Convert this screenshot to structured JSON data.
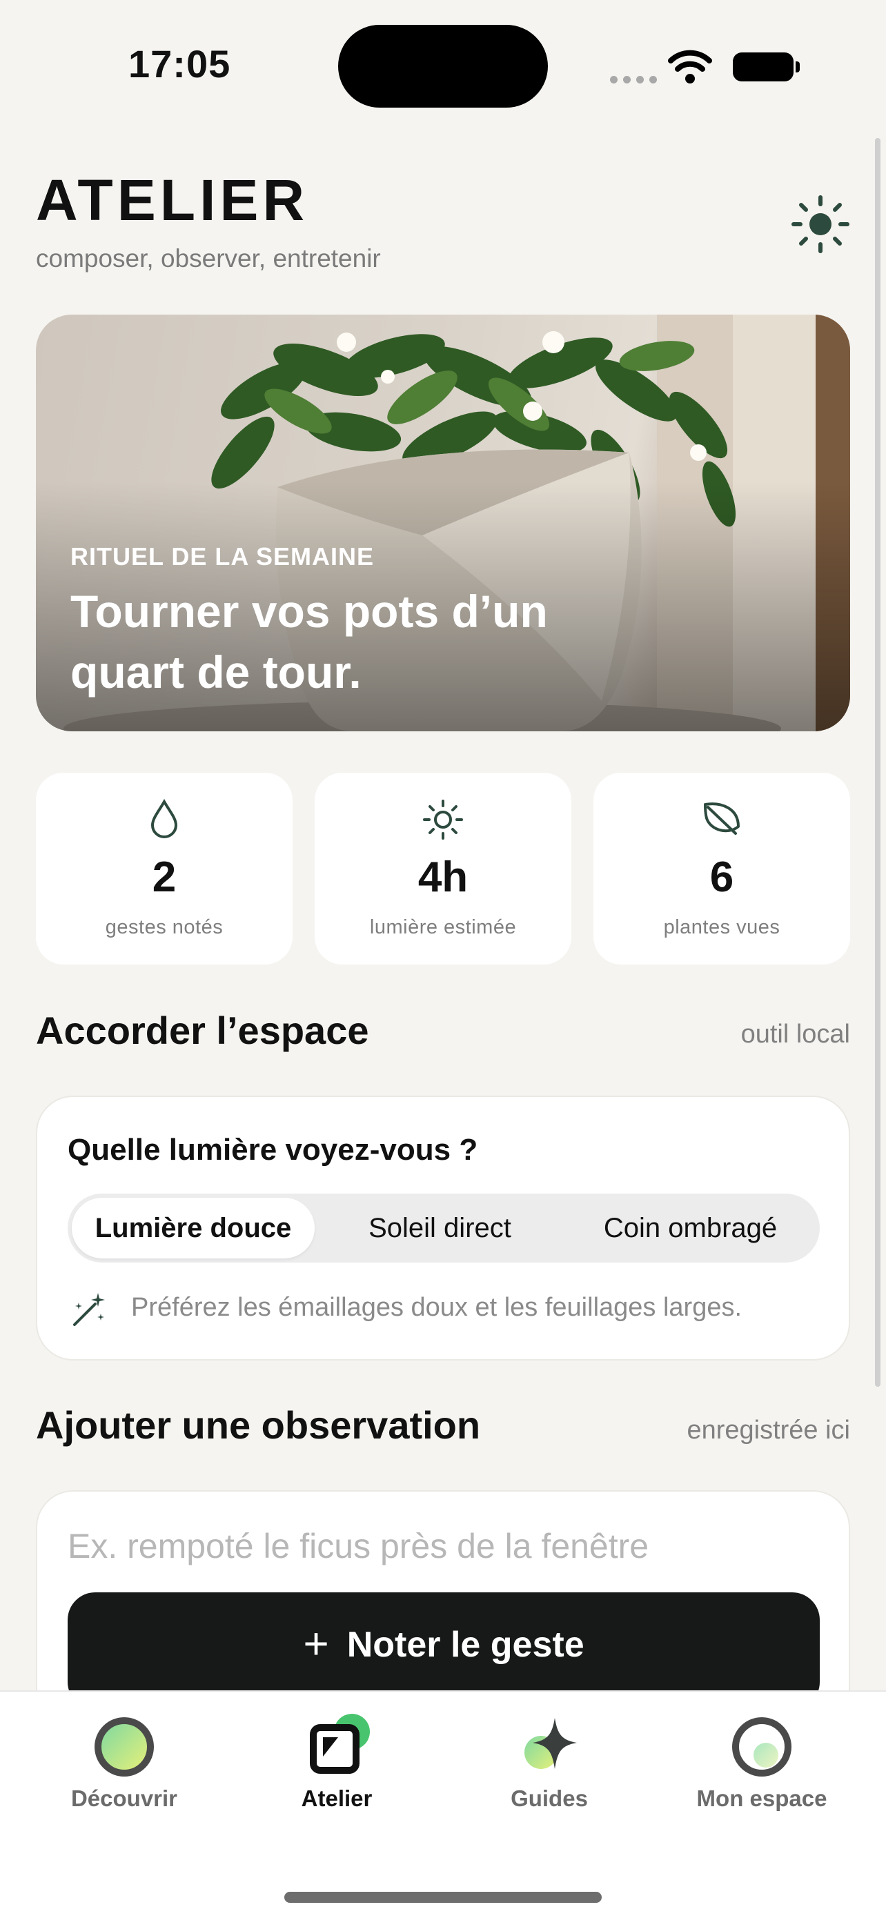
{
  "status_bar": {
    "time": "17:05"
  },
  "header": {
    "title": "ATELIER",
    "subtitle": "composer, observer, entretenir",
    "theme_icon": "sun-icon"
  },
  "hero": {
    "kicker": "RITUEL DE LA SEMAINE",
    "text": "Tourner vos pots d’un quart de tour."
  },
  "stats": [
    {
      "icon": "drop-icon",
      "value": "2",
      "label": "gestes notés"
    },
    {
      "icon": "sun-icon",
      "value": "4h",
      "label": "lumière estimée"
    },
    {
      "icon": "leaf-icon",
      "value": "6",
      "label": "plantes vues"
    }
  ],
  "space": {
    "title": "Accorder l’espace",
    "meta": "outil local",
    "question": "Quelle lumière voyez-vous ?",
    "options": [
      "Lumière douce",
      "Soleil direct",
      "Coin ombragé"
    ],
    "selected": "Lumière douce",
    "tip": "Préférez les émaillages doux et les feuillages larges."
  },
  "observation": {
    "title": "Ajouter une observation",
    "meta": "enregistrée ici",
    "placeholder": "Ex. rempoté le ficus près de la fenêtre",
    "button_label": "Noter le geste"
  },
  "tabbar": {
    "active": "Atelier",
    "tabs": [
      {
        "label": "Découvrir",
        "icon": "discover-icon"
      },
      {
        "label": "Atelier",
        "icon": "atelier-icon"
      },
      {
        "label": "Guides",
        "icon": "sparkle-icon"
      },
      {
        "label": "Mon espace",
        "icon": "profile-icon"
      }
    ]
  },
  "colors": {
    "accent": "#2d4a3e",
    "background": "#f5f4f0",
    "button": "#161918"
  }
}
